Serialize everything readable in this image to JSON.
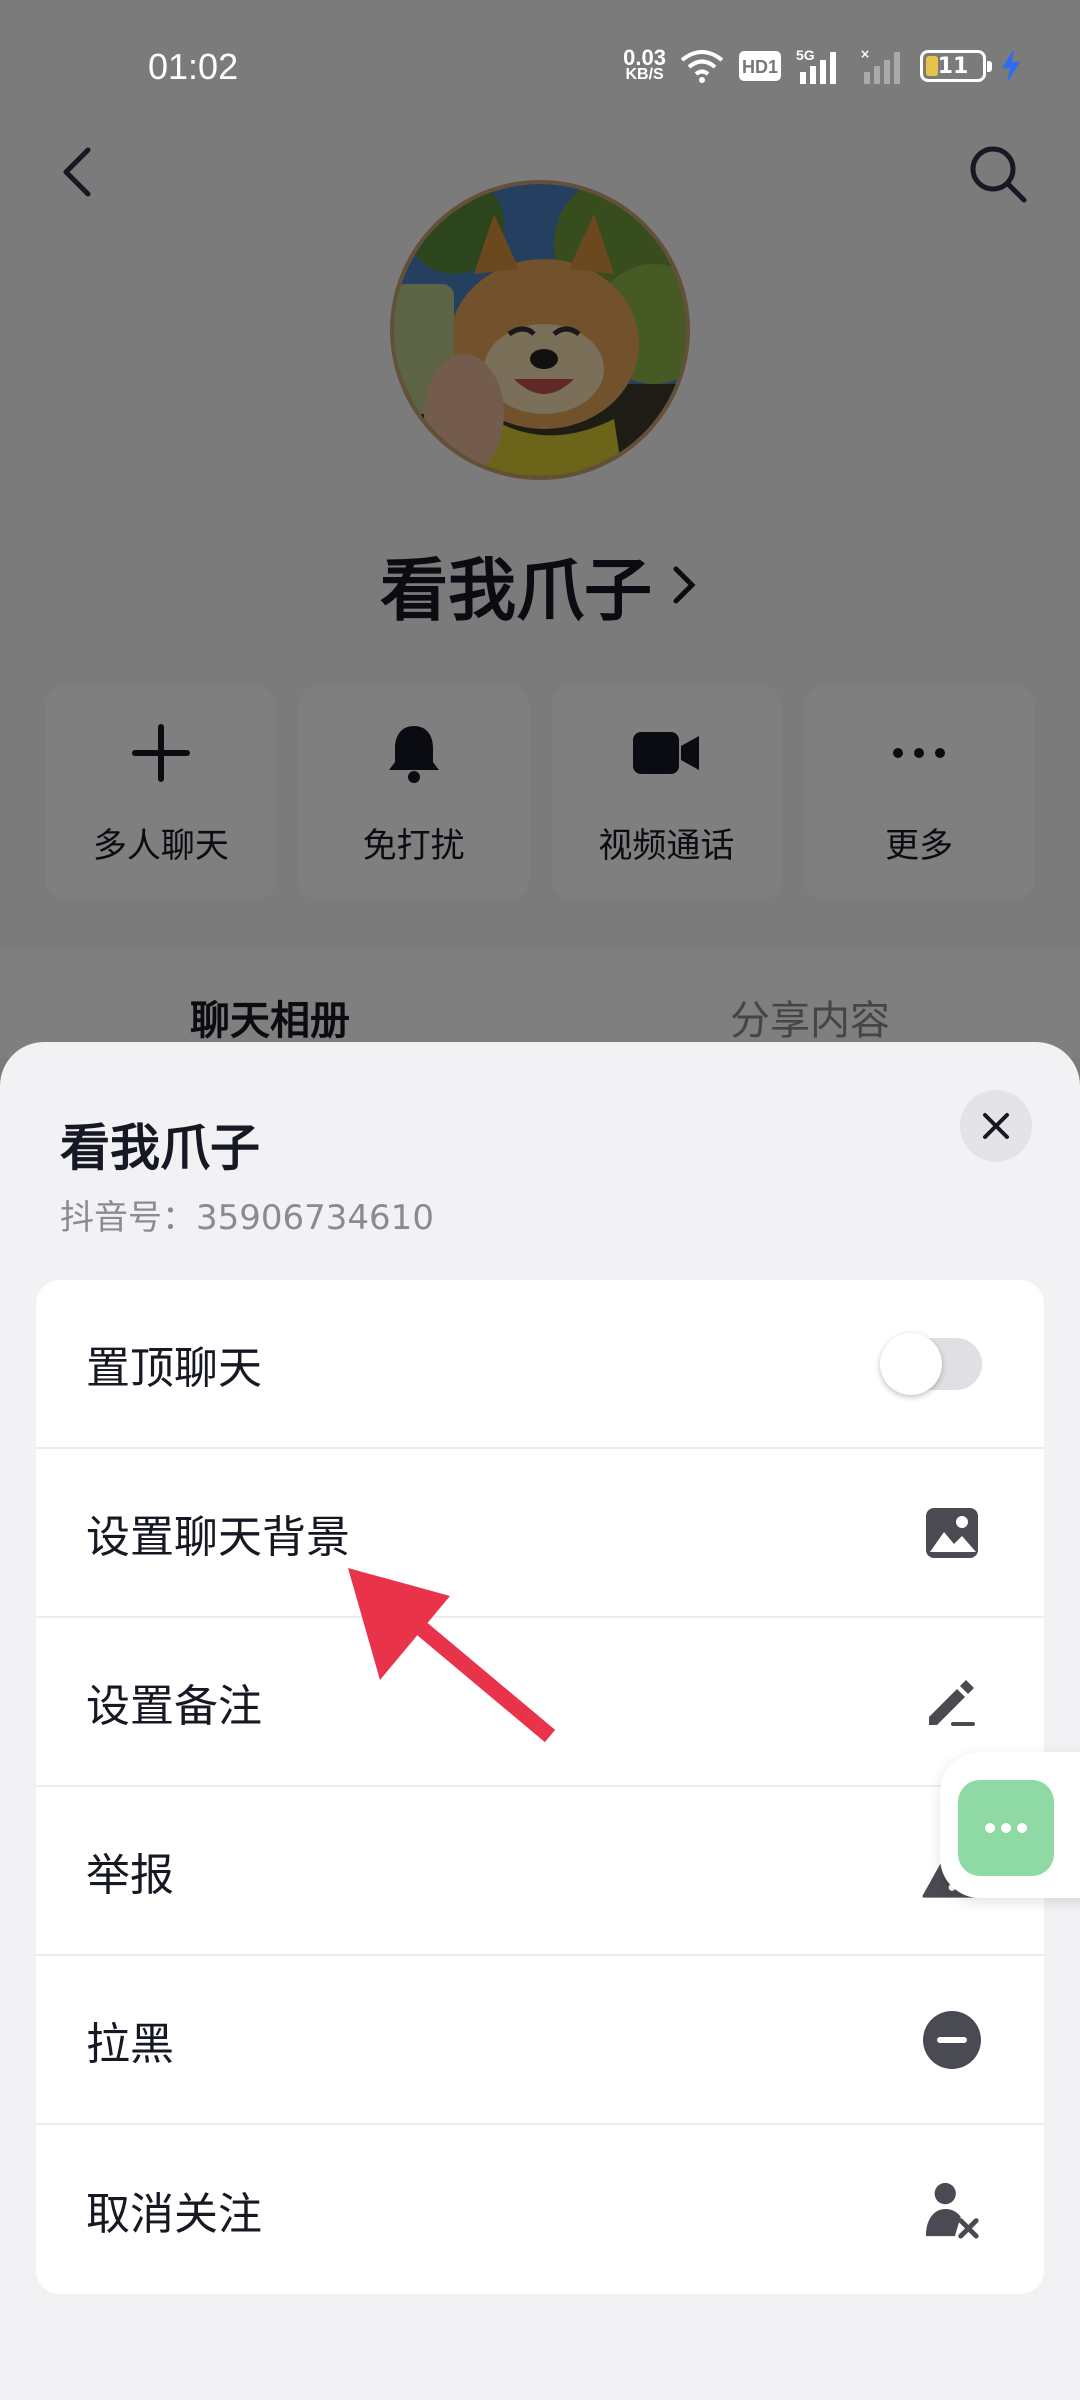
{
  "status_bar": {
    "time": "01:02",
    "net_speed_value": "0.03",
    "net_speed_unit": "KB/S",
    "hd_badge": "HD1",
    "network": "5G",
    "battery": "11",
    "icons": [
      "wifi-icon",
      "hd-icon",
      "signal-5g-icon",
      "signal-icon",
      "battery-icon",
      "charging-icon"
    ]
  },
  "header": {
    "back_icon": "chevron-left-icon",
    "search_icon": "search-icon"
  },
  "profile": {
    "nickname": "看我爪子",
    "actions": [
      {
        "label": "多人聊天",
        "icon": "plus-icon"
      },
      {
        "label": "免打扰",
        "icon": "bell-icon"
      },
      {
        "label": "视频通话",
        "icon": "video-camera-icon"
      },
      {
        "label": "更多",
        "icon": "more-dots-icon"
      }
    ],
    "tabs": [
      "聊天相册",
      "分享内容"
    ]
  },
  "sheet": {
    "title": "看我爪子",
    "subtitle": "抖音号：35906734610",
    "close_icon": "close-icon",
    "items": [
      {
        "label": "置顶聊天",
        "control": "toggle",
        "toggle_on": false
      },
      {
        "label": "设置聊天背景",
        "icon": "image-icon"
      },
      {
        "label": "设置备注",
        "icon": "pencil-icon"
      },
      {
        "label": "举报",
        "icon": "warning-icon"
      },
      {
        "label": "拉黑",
        "icon": "block-icon"
      },
      {
        "label": "取消关注",
        "icon": "user-remove-icon"
      }
    ]
  },
  "colors": {
    "accent_arrow": "#e8334a",
    "float_button": "#8fd9a4",
    "text_primary": "#161823",
    "text_secondary": "#8a8b91"
  }
}
